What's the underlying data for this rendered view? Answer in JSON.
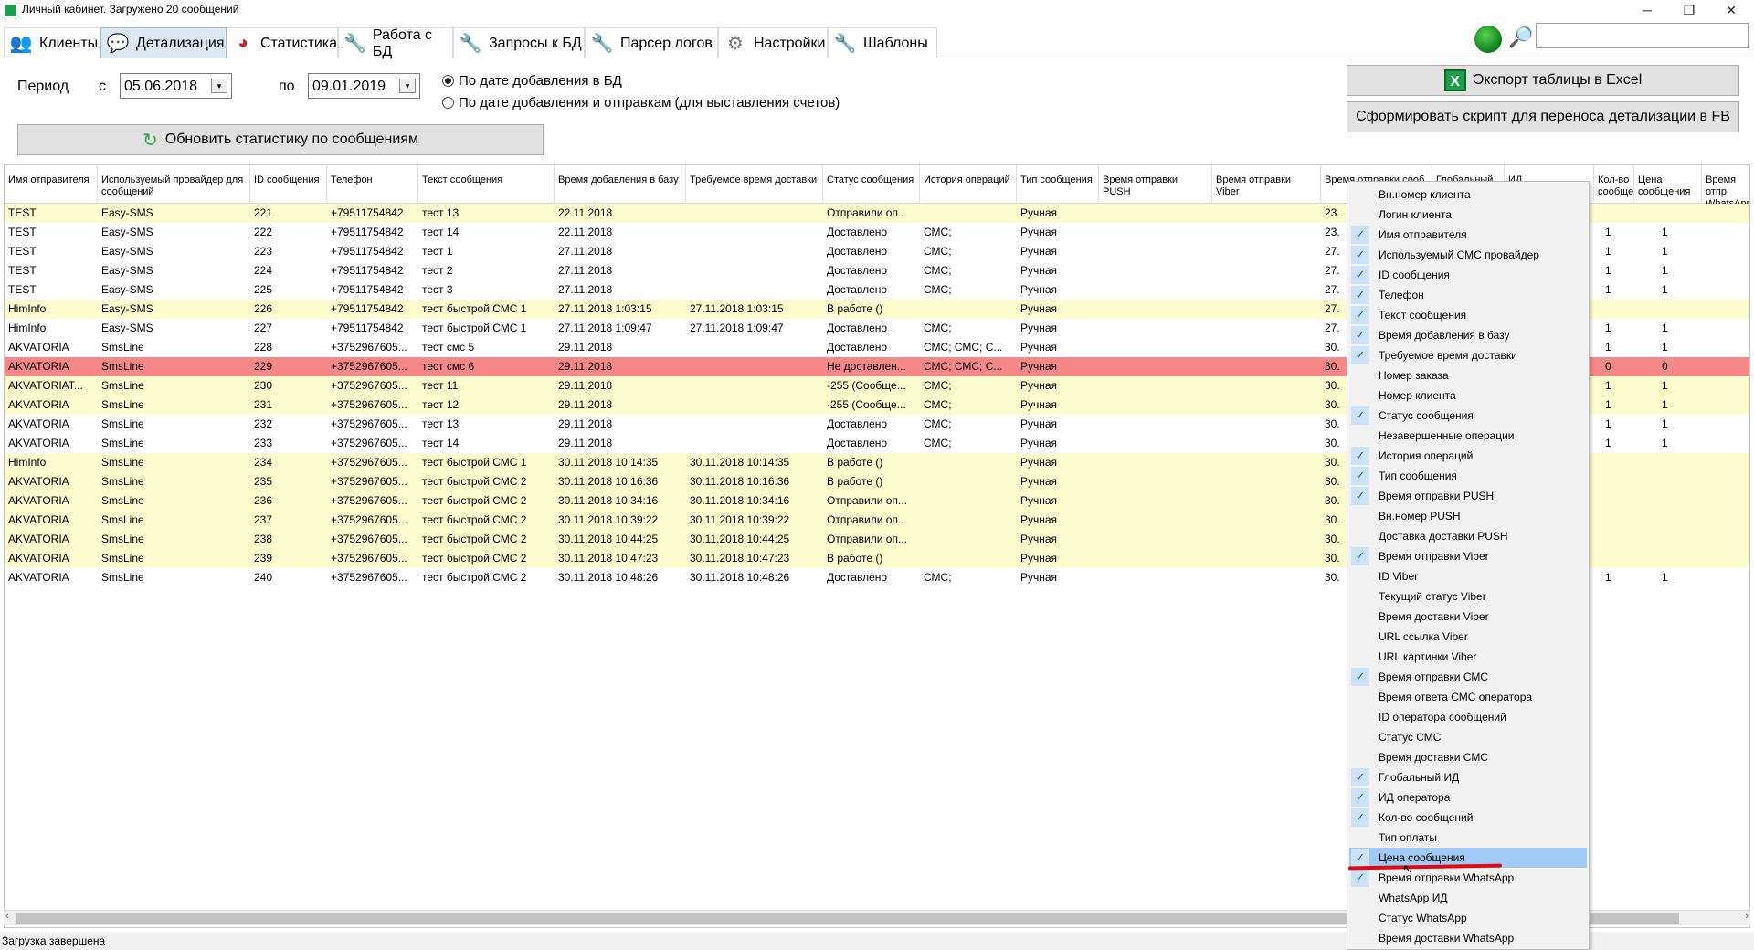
{
  "window": {
    "title": "Личный кабинет. Загружено 20 сообщений"
  },
  "tabs": [
    {
      "label": "Клиенты",
      "icon": "users-icon"
    },
    {
      "label": "Детализация",
      "icon": "chat-bubbles-icon"
    },
    {
      "label": "Статистика",
      "icon": "pie-chart-icon"
    },
    {
      "label": "Работа с БД",
      "icon": "wrench-icon"
    },
    {
      "label": "Запросы к БД",
      "icon": "wrench-icon"
    },
    {
      "label": "Парсер логов",
      "icon": "wrench-icon"
    },
    {
      "label": "Настройки",
      "icon": "gear-icon"
    },
    {
      "label": "Шаблоны",
      "icon": "wrench-icon"
    }
  ],
  "filter": {
    "period_label": "Период",
    "from_label": "с",
    "from_date": "05.06.2018",
    "to_label": "по",
    "to_date": "09.01.2019",
    "radio1": "По дате добавления в БД",
    "radio2": "По дате добавления и отправкам (для выставления счетов)",
    "refresh_button": "Обновить статистику по сообщениям",
    "export_button": "Экспорт таблицы в Excel",
    "script_button": "Сформировать скрипт для переноса детализации в FB"
  },
  "columns": [
    "Имя отправителя",
    "Используемый провайдер для сообщений",
    "ID сообщения",
    "Телефон",
    "Текст сообщения",
    "Время добавления в базу",
    "Требуемое время доставки",
    "Статус сообщения",
    "История операций",
    "Тип сообщения",
    "Время отправки PUSH",
    "Время отправки Viber",
    "Время отправки сооб",
    "Глобальный",
    "ИД",
    "Кол-во сообщений",
    "Цена сообщения",
    "Время отпр WhatsApp"
  ],
  "rows": [
    {
      "hl": "y",
      "c": [
        "TEST",
        "Easy-SMS",
        "221",
        "+79511754842",
        "тест 13",
        "22.11.2018",
        "",
        "Отправили оп...",
        "",
        "Ручная",
        "23.",
        "",
        ""
      ]
    },
    {
      "hl": "",
      "c": [
        "TEST",
        "Easy-SMS",
        "222",
        "+79511754842",
        "тест 14",
        "22.11.2018",
        "",
        "Доставлено",
        "СМС;",
        "Ручная",
        "23.",
        "1",
        "1"
      ]
    },
    {
      "hl": "",
      "c": [
        "TEST",
        "Easy-SMS",
        "223",
        "+79511754842",
        "тест 1",
        "27.11.2018",
        "",
        "Доставлено",
        "СМС;",
        "Ручная",
        "27.",
        "1",
        "1"
      ]
    },
    {
      "hl": "",
      "c": [
        "TEST",
        "Easy-SMS",
        "224",
        "+79511754842",
        "тест 2",
        "27.11.2018",
        "",
        "Доставлено",
        "СМС;",
        "Ручная",
        "27.",
        "1",
        "1"
      ]
    },
    {
      "hl": "",
      "c": [
        "TEST",
        "Easy-SMS",
        "225",
        "+79511754842",
        "тест 3",
        "27.11.2018",
        "",
        "Доставлено",
        "СМС;",
        "Ручная",
        "27.",
        "1",
        "1"
      ]
    },
    {
      "hl": "y",
      "c": [
        "HimInfo",
        "Easy-SMS",
        "226",
        "+79511754842",
        "тест быстрой СМС 1",
        "27.11.2018 1:03:15",
        "27.11.2018 1:03:15",
        "В работе ()",
        "",
        "Ручная",
        "27.",
        "",
        ""
      ]
    },
    {
      "hl": "",
      "c": [
        "HimInfo",
        "Easy-SMS",
        "227",
        "+79511754842",
        "тест быстрой СМС 1",
        "27.11.2018 1:09:47",
        "27.11.2018 1:09:47",
        "Доставлено",
        "СМС;",
        "Ручная",
        "27.",
        "1",
        "1"
      ]
    },
    {
      "hl": "",
      "c": [
        "AKVATORIA",
        "SmsLine",
        "228",
        "+3752967605...",
        "тест смс 5",
        "29.11.2018",
        "",
        "Доставлено",
        "СМС; СМС; С...",
        "Ручная",
        "30.",
        "1",
        "1"
      ]
    },
    {
      "hl": "r",
      "c": [
        "AKVATORIA",
        "SmsLine",
        "229",
        "+3752967605...",
        "тест смс 6",
        "29.11.2018",
        "",
        "Не доставлен...",
        "СМС; СМС; С...",
        "Ручная",
        "30.",
        "0",
        "0"
      ]
    },
    {
      "hl": "y",
      "c": [
        "AKVATORIAT...",
        "SmsLine",
        "230",
        "+3752967605...",
        "тест 11",
        "29.11.2018",
        "",
        "-255 (Сообще...",
        "СМС;",
        "Ручная",
        "30.",
        "1",
        "1"
      ]
    },
    {
      "hl": "y",
      "c": [
        "AKVATORIA",
        "SmsLine",
        "231",
        "+3752967605...",
        "тест 12",
        "29.11.2018",
        "",
        "-255 (Сообще...",
        "СМС;",
        "Ручная",
        "30.",
        "1",
        "1"
      ]
    },
    {
      "hl": "",
      "c": [
        "AKVATORIA",
        "SmsLine",
        "232",
        "+3752967605...",
        "тест 13",
        "29.11.2018",
        "",
        "Доставлено",
        "СМС;",
        "Ручная",
        "30.",
        "1",
        "1"
      ]
    },
    {
      "hl": "",
      "c": [
        "AKVATORIA",
        "SmsLine",
        "233",
        "+3752967605...",
        "тест 14",
        "29.11.2018",
        "",
        "Доставлено",
        "СМС;",
        "Ручная",
        "30.",
        "1",
        "1"
      ]
    },
    {
      "hl": "y",
      "c": [
        "HimInfo",
        "SmsLine",
        "234",
        "+3752967605...",
        "тест быстрой СМС 1",
        "30.11.2018 10:14:35",
        "30.11.2018 10:14:35",
        "В работе ()",
        "",
        "Ручная",
        "30.",
        "",
        ""
      ]
    },
    {
      "hl": "y",
      "c": [
        "AKVATORIA",
        "SmsLine",
        "235",
        "+3752967605...",
        "тест быстрой СМС 2",
        "30.11.2018 10:16:36",
        "30.11.2018 10:16:36",
        "В работе ()",
        "",
        "Ручная",
        "30.",
        "",
        ""
      ]
    },
    {
      "hl": "y",
      "c": [
        "AKVATORIA",
        "SmsLine",
        "236",
        "+3752967605...",
        "тест быстрой СМС 2",
        "30.11.2018 10:34:16",
        "30.11.2018 10:34:16",
        "Отправили оп...",
        "",
        "Ручная",
        "30.",
        "",
        ""
      ]
    },
    {
      "hl": "y",
      "c": [
        "AKVATORIA",
        "SmsLine",
        "237",
        "+3752967605...",
        "тест быстрой СМС 2",
        "30.11.2018 10:39:22",
        "30.11.2018 10:39:22",
        "Отправили оп...",
        "",
        "Ручная",
        "30.",
        "",
        ""
      ]
    },
    {
      "hl": "y",
      "c": [
        "AKVATORIA",
        "SmsLine",
        "238",
        "+3752967605...",
        "тест быстрой СМС 2",
        "30.11.2018 10:44:25",
        "30.11.2018 10:44:25",
        "Отправили оп...",
        "",
        "Ручная",
        "30.",
        "",
        ""
      ]
    },
    {
      "hl": "y",
      "c": [
        "AKVATORIA",
        "SmsLine",
        "239",
        "+3752967605...",
        "тест быстрой СМС 2",
        "30.11.2018 10:47:23",
        "30.11.2018 10:47:23",
        "В работе ()",
        "",
        "Ручная",
        "30.",
        "",
        ""
      ]
    },
    {
      "hl": "",
      "c": [
        "AKVATORIA",
        "SmsLine",
        "240",
        "+3752967605...",
        "тест быстрой СМС 2",
        "30.11.2018 10:48:26",
        "30.11.2018 10:48:26",
        "Доставлено",
        "СМС;",
        "Ручная",
        "30.",
        "1",
        "1"
      ]
    }
  ],
  "menu": [
    {
      "label": "Вн.номер клиента",
      "checked": false
    },
    {
      "label": "Логин клиента",
      "checked": false
    },
    {
      "label": "Имя отправителя",
      "checked": true
    },
    {
      "label": "Используемый СМС провайдер",
      "checked": true
    },
    {
      "label": "ID сообщения",
      "checked": true
    },
    {
      "label": "Телефон",
      "checked": true
    },
    {
      "label": "Текст сообщения",
      "checked": true
    },
    {
      "label": "Время добавления в базу",
      "checked": true
    },
    {
      "label": "Требуемое время доставки",
      "checked": true
    },
    {
      "label": "Номер заказа",
      "checked": false
    },
    {
      "label": "Номер клиента",
      "checked": false
    },
    {
      "label": "Статус сообщения",
      "checked": true
    },
    {
      "label": "Незавершенные операции",
      "checked": false
    },
    {
      "label": "История операций",
      "checked": true
    },
    {
      "label": "Тип сообщения",
      "checked": true
    },
    {
      "label": "Время отправки PUSH",
      "checked": true
    },
    {
      "label": "Вн.номер PUSH",
      "checked": false
    },
    {
      "label": "Доставка доставки PUSH",
      "checked": false
    },
    {
      "label": "Время отправки Viber",
      "checked": true
    },
    {
      "label": "ID Viber",
      "checked": false
    },
    {
      "label": "Текущий статус Viber",
      "checked": false
    },
    {
      "label": "Время доставки Viber",
      "checked": false
    },
    {
      "label": "URL ссылка Viber",
      "checked": false
    },
    {
      "label": "URL картинки Viber",
      "checked": false
    },
    {
      "label": "Время отправки СМС",
      "checked": true
    },
    {
      "label": "Время ответа СМС оператора",
      "checked": false
    },
    {
      "label": "ID оператора сообщений",
      "checked": false
    },
    {
      "label": "Статус СМС",
      "checked": false
    },
    {
      "label": "Время доставки СМС",
      "checked": false
    },
    {
      "label": "Глобальный ИД",
      "checked": true
    },
    {
      "label": "ИД оператора",
      "checked": true
    },
    {
      "label": "Кол-во сообщений",
      "checked": true
    },
    {
      "label": "Тип оплаты",
      "checked": false
    },
    {
      "label": "Цена сообщения",
      "checked": true,
      "highlight": true
    },
    {
      "label": "Время отправки WhatsApp",
      "checked": true
    },
    {
      "label": "WhatsApp ИД",
      "checked": false
    },
    {
      "label": "Статус WhatsApp",
      "checked": false
    },
    {
      "label": "Время доставки WhatsApp",
      "checked": false
    }
  ],
  "status": "Загрузка завершена"
}
